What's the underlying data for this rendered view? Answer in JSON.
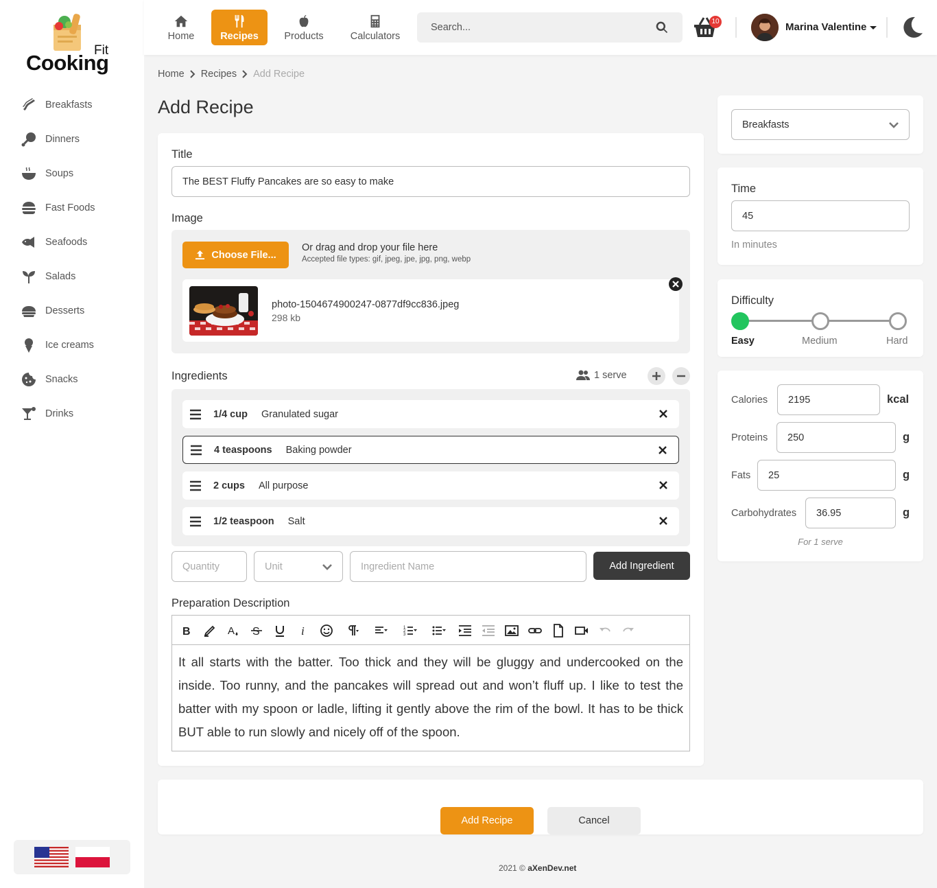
{
  "brand": {
    "name": "Cooking",
    "tag": "Fit"
  },
  "sidebar": {
    "items": [
      {
        "label": "Breakfasts",
        "icon": "bacon-icon"
      },
      {
        "label": "Dinners",
        "icon": "drumstick-icon"
      },
      {
        "label": "Soups",
        "icon": "soup-bowl-icon"
      },
      {
        "label": "Fast Foods",
        "icon": "burger-icon"
      },
      {
        "label": "Seafoods",
        "icon": "fish-icon"
      },
      {
        "label": "Salads",
        "icon": "seedling-icon"
      },
      {
        "label": "Desserts",
        "icon": "pie-icon"
      },
      {
        "label": "Ice creams",
        "icon": "ice-cream-icon"
      },
      {
        "label": "Snacks",
        "icon": "cookie-icon"
      },
      {
        "label": "Drinks",
        "icon": "cocktail-icon"
      }
    ]
  },
  "topnav": {
    "tabs": [
      {
        "label": "Home",
        "icon": "home-icon"
      },
      {
        "label": "Recipes",
        "icon": "utensils-icon",
        "active": true
      },
      {
        "label": "Products",
        "icon": "apple-icon"
      },
      {
        "label": "Calculators",
        "icon": "calculator-icon"
      }
    ],
    "search_placeholder": "Search...",
    "cart_count": "10",
    "user_name": "Marina Valentine"
  },
  "breadcrumb": [
    "Home",
    "Recipes",
    "Add Recipe"
  ],
  "page_title": "Add Recipe",
  "form": {
    "title_label": "Title",
    "title_value": "The BEST Fluffy Pancakes are so easy to make",
    "image_label": "Image",
    "choose_file": "Choose File...",
    "drag_text": "Or drag and drop your file here",
    "accepted": "Accepted file types: gif, jpeg, jpe, jpg, png, webp",
    "file_name": "photo-1504674900247-0877df9cc836.jpeg",
    "file_size": "298 kb",
    "ingredients_label": "Ingredients",
    "serve_text": "1 serve",
    "ingredients": [
      {
        "qty": "1/4 cup",
        "name": "Granulated sugar"
      },
      {
        "qty": "4 teaspoons",
        "name": "Baking powder"
      },
      {
        "qty": "2 cups",
        "name": "All purpose"
      },
      {
        "qty": "1/2 teaspoon",
        "name": "Salt"
      }
    ],
    "quantity_ph": "Quantity",
    "unit_ph": "Unit",
    "ingredient_name_ph": "Ingredient Name",
    "add_ingredient": "Add Ingredient",
    "description_label": "Preparation Description",
    "description": "It all starts with the batter. Too thick and they will be gluggy and undercooked on the inside. Too runny, and the pancakes will spread out and won’t fluff up. I like to test the batter with my spoon or ladle, lifting it gently above the rim of the bowl. It has to be thick BUT able to run slowly and nicely off of the spoon."
  },
  "side": {
    "category": "Breakfasts",
    "time_label": "Time",
    "time_value": "45",
    "time_hint": "In minutes",
    "difficulty_label": "Difficulty",
    "difficulty": [
      "Easy",
      "Medium",
      "Hard"
    ],
    "difficulty_selected": "Easy",
    "nutrition": [
      {
        "label": "Calories",
        "value": "2195",
        "unit": "kcal"
      },
      {
        "label": "Proteins",
        "value": "250",
        "unit": "g"
      },
      {
        "label": "Fats",
        "value": "25",
        "unit": "g"
      },
      {
        "label": "Carbohydrates",
        "value": "36.95",
        "unit": "g"
      }
    ],
    "nutrition_hint": "For 1 serve"
  },
  "actions": {
    "submit": "Add Recipe",
    "cancel": "Cancel"
  },
  "footer": {
    "year": "2021 ©",
    "site": "aXenDev.net"
  },
  "colors": {
    "accent": "#ed9314",
    "dark_button": "#3b3b3b",
    "easy_green": "#22c55e",
    "badge_red": "#e53935"
  }
}
